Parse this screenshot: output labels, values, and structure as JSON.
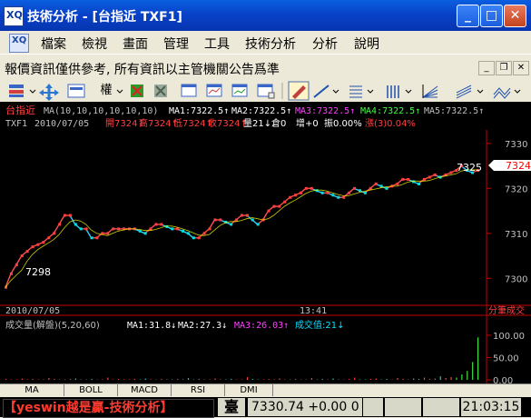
{
  "window": {
    "title": "技術分析 - [台指近 TXF1]",
    "icon_text": "XQ",
    "minimize": "_",
    "maximize": "□",
    "close": "✕"
  },
  "menu": {
    "items": [
      "檔案",
      "檢視",
      "畫面",
      "管理",
      "工具",
      "技術分析",
      "分析",
      "說明"
    ]
  },
  "notice": {
    "text": "報價資訊僅供參考, 所有資訊以主管機關公告爲準",
    "min": "_",
    "restore": "❐",
    "close": "✕"
  },
  "toolbar": {
    "dropdown_label": "權",
    "icons": [
      "columns-icon",
      "move-icon",
      "bars-icon",
      "dropdown",
      "cross-color-icon",
      "cross-gray-icon",
      "window-1-icon",
      "window-2-icon",
      "window-3-icon",
      "window-4-icon",
      "edit-icon",
      "line-icon",
      "fib-icon",
      "grid-lines-icon",
      "fan-icon",
      "channel-icon",
      "wave-icon"
    ]
  },
  "chart": {
    "symbol": "台指近",
    "ma_header": "MA(10,10,10,10,10,10)",
    "ma1": "MA1:7322.5↑",
    "ma2": "MA2:7322.5↑",
    "ma3": "MA3:7322.5↑",
    "ma4": "MA4:7322.5↑",
    "ma5": "MA5:7322.5↑",
    "info_code": "TXF1",
    "info_date": "2010/07/05",
    "info_open": "開7324↑",
    "info_high": "高7324↑",
    "info_low": "低7324↑",
    "info_close": "收7324↑",
    "info_vol": "量21↓",
    "info_oi": "倉0",
    "info_add": "增+0",
    "info_amp": "振0.00%",
    "info_chg": "漲(3)0.04%",
    "price_ticks": [
      "7330",
      "7320",
      "7310",
      "7300"
    ],
    "current_price": "7324",
    "high_label": "7325",
    "low_label": "7298",
    "date_label": "2010/07/05",
    "time_label": "13:41",
    "corner_label": "分筆成交",
    "vol_header": "成交量(解盤)(5,20,60)",
    "vol_ma1": "MA1:31.8↓",
    "vol_ma2": "MA2:27.3↓",
    "vol_ma3": "MA3:26.03↑",
    "vol_value": "成交值:21↓",
    "vol_ticks": [
      "100.00",
      "50.00",
      "0.00"
    ],
    "colors": {
      "up": "#ff4040",
      "down": "#00e0e0",
      "ma": "#ffff00",
      "axis": "#c00000",
      "text": "#c0c0c0"
    }
  },
  "chart_data": {
    "type": "line",
    "title": "",
    "xlabel": "",
    "ylabel": "",
    "ylim": [
      7294,
      7333
    ],
    "x": [
      0,
      6,
      12,
      18,
      24,
      30,
      36,
      42,
      48,
      54,
      60,
      66,
      72,
      78,
      84,
      90,
      96,
      102,
      108,
      114,
      120,
      126,
      132,
      138,
      144,
      150,
      156,
      162,
      168,
      174,
      180,
      186,
      192,
      198,
      204,
      210,
      216,
      222,
      228,
      234,
      240,
      246,
      252,
      258,
      264,
      270,
      276,
      282,
      288,
      294,
      300,
      306,
      312,
      318,
      324,
      330,
      336,
      342,
      348,
      354,
      360,
      366,
      372,
      378,
      384,
      390,
      396,
      402,
      408,
      414,
      420,
      426,
      432,
      438,
      444,
      450,
      456,
      462,
      468,
      474,
      480,
      486,
      492,
      498,
      504,
      510,
      516,
      522,
      528
    ],
    "values": [
      7298,
      7301,
      7303,
      7305,
      7306,
      7307,
      7307.5,
      7308,
      7309,
      7310,
      7312,
      7314,
      7314,
      7312,
      7311,
      7311,
      7309,
      7309,
      7310,
      7310,
      7311,
      7311,
      7311,
      7311,
      7311,
      7310.5,
      7310,
      7311,
      7312,
      7312,
      7311.5,
      7311,
      7311,
      7310.5,
      7310,
      7309,
      7309,
      7310,
      7311,
      7313,
      7313,
      7312.5,
      7312,
      7313,
      7314,
      7314,
      7313,
      7312,
      7313,
      7315,
      7316,
      7316,
      7317,
      7318,
      7318.5,
      7319,
      7320,
      7320,
      7319.5,
      7319,
      7319,
      7318.5,
      7318,
      7318,
      7319,
      7320,
      7319.5,
      7319,
      7320,
      7321,
      7320.5,
      7320,
      7320.5,
      7321,
      7322,
      7322,
      7321.5,
      7321,
      7322,
      7322.5,
      7323,
      7322.5,
      7323,
      7323.5,
      7324,
      7325,
      7324,
      7323.5,
      7324
    ],
    "volume_ylim": [
      0,
      110
    ],
    "volume": [
      2,
      1,
      1,
      3,
      1,
      2,
      1,
      1,
      4,
      2,
      1,
      1,
      2,
      3,
      1,
      1,
      2,
      1,
      1,
      5,
      1,
      2,
      1,
      1,
      2,
      1,
      3,
      1,
      1,
      2,
      1,
      1,
      2,
      1,
      4,
      1,
      2,
      1,
      1,
      3,
      1,
      1,
      2,
      1,
      1,
      6,
      2,
      1,
      1,
      2,
      1,
      3,
      1,
      1,
      2,
      1,
      1,
      4,
      1,
      2,
      1,
      3,
      1,
      1,
      2,
      5,
      1,
      1,
      2,
      3,
      1,
      2,
      1,
      4,
      2,
      1,
      3,
      2,
      5,
      2,
      3,
      8,
      4,
      6,
      5,
      12,
      20,
      40,
      95
    ]
  },
  "tabs": [
    "MA",
    "BOLL",
    "MACD",
    "RSI",
    "DMI"
  ],
  "status": {
    "ticker": "【yeswin越是贏-技術分析】",
    "chip": "臺",
    "index": "7330.74 +0.00 0",
    "time": "21:03:15"
  }
}
